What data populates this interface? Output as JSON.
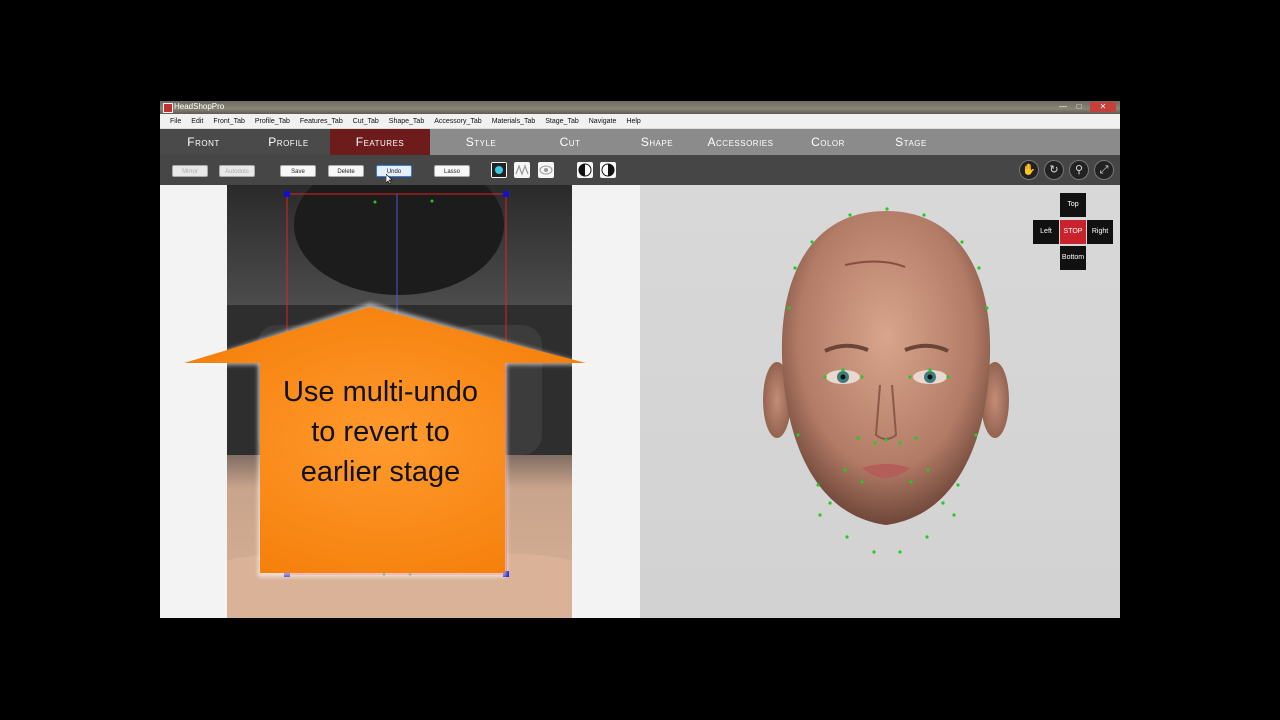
{
  "window": {
    "title": "HeadShopPro",
    "min": "—",
    "max": "□",
    "close": "✕"
  },
  "menu": [
    "File",
    "Edit",
    "Front_Tab",
    "Profile_Tab",
    "Features_Tab",
    "Cut_Tab",
    "Shape_Tab",
    "Accessory_Tab",
    "Materials_Tab",
    "Stage_Tab",
    "Navigate",
    "Help"
  ],
  "tabs": {
    "front": "Front",
    "profile": "Profile",
    "features": "Features",
    "style": "Style",
    "cut": "Cut",
    "shape": "Shape",
    "accessories": "Accessories",
    "color": "Color",
    "stage": "Stage"
  },
  "toolbar": {
    "mirror": "Mirror",
    "autodots": "Autodots",
    "save": "Save",
    "delete": "Delete",
    "undo": "Undo",
    "lasso": "Lasso"
  },
  "tool_icons": [
    "dot-mode-icon",
    "wave-icon",
    "eye-icon",
    "half-circle-left-icon",
    "half-circle-right-icon",
    "hand-icon",
    "rotate-icon",
    "zoom-icon",
    "fit-icon"
  ],
  "callout": {
    "text": "Use multi-undo to revert to earlier stage",
    "color": "#f7941d"
  },
  "navigator": {
    "top": "Top",
    "left": "Left",
    "stop": "STOP",
    "right": "Right",
    "bottom": "Bottom"
  },
  "colors": {
    "feature_tab": "#6e1b1b",
    "stop": "#c8222c",
    "landmark": "#22cc22"
  }
}
